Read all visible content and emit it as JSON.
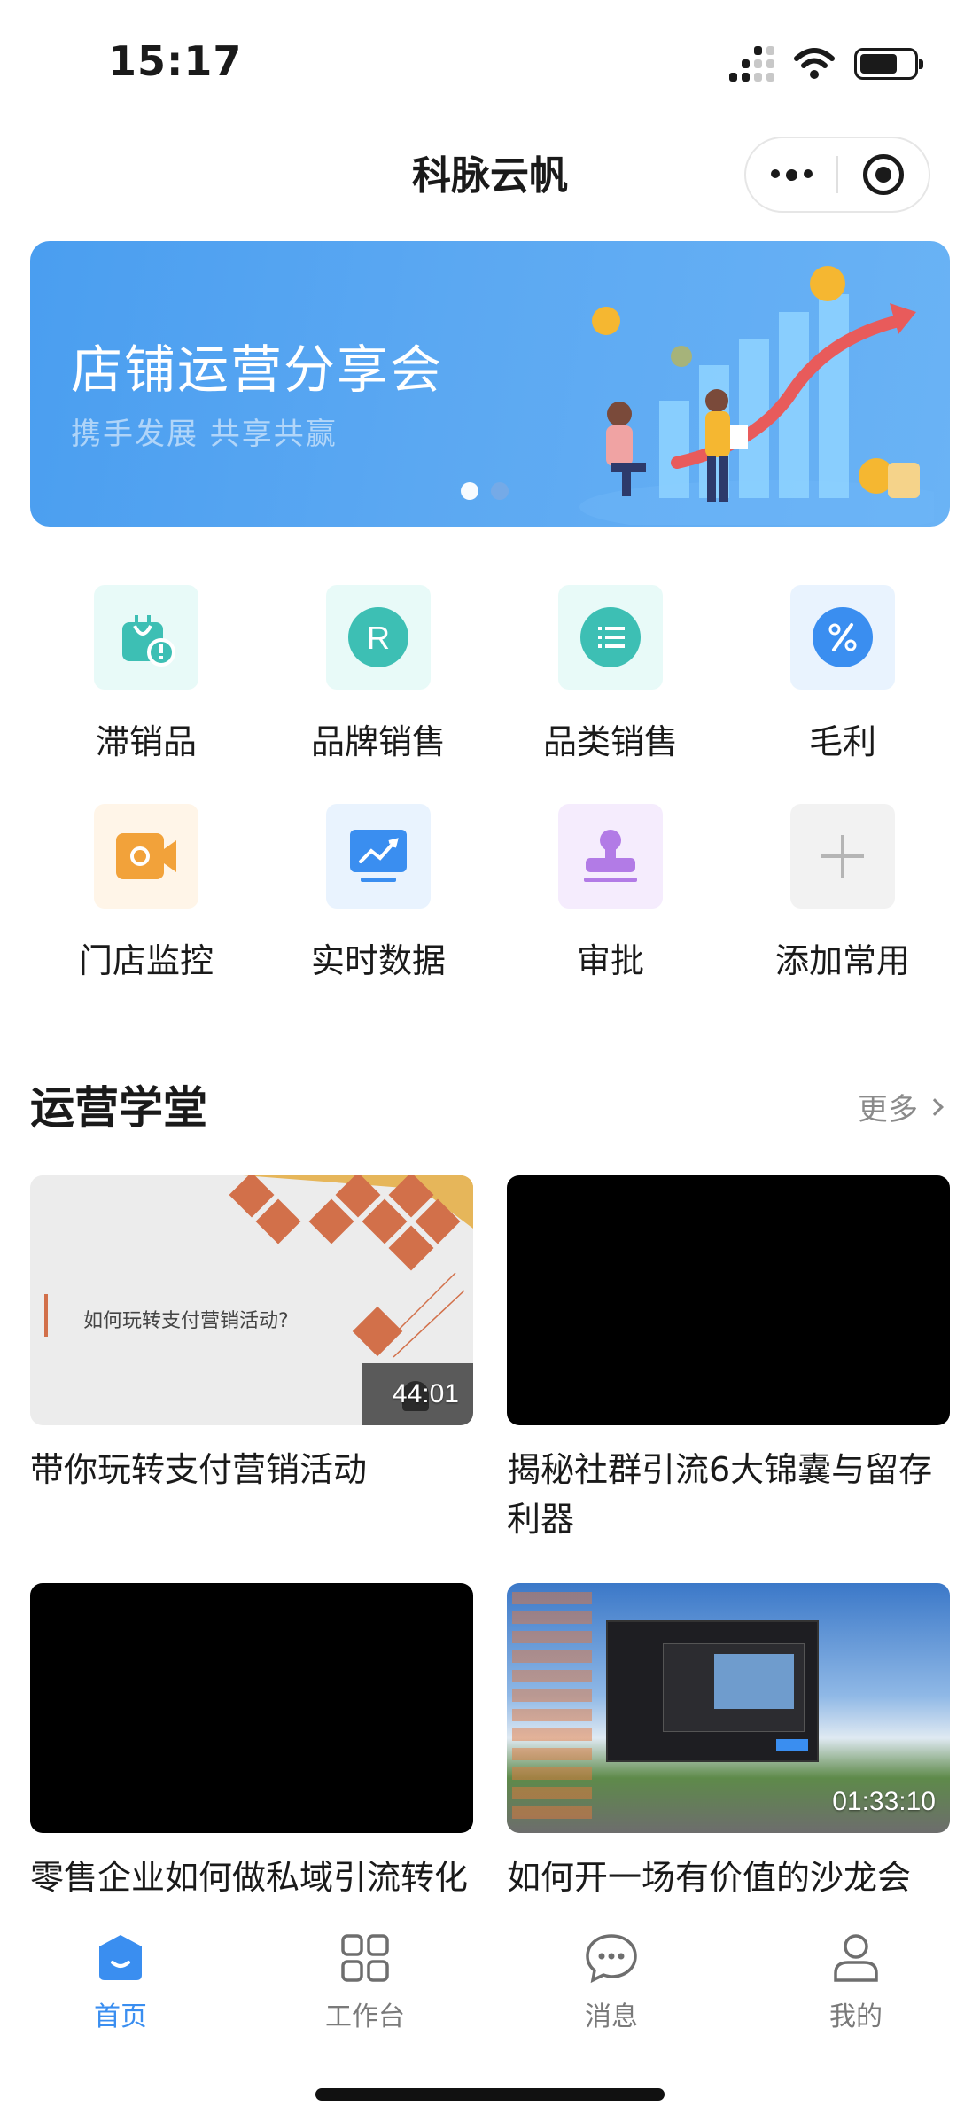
{
  "status": {
    "time": "15:17"
  },
  "nav": {
    "title": "科脉云帆"
  },
  "banner": {
    "title": "店铺运营分享会",
    "subtitle": "携手发展  共享共赢"
  },
  "grid": [
    {
      "label": "滞销品",
      "icon": "bag-warning-icon",
      "bg": "#e8faf8",
      "color": "#3dbfb4"
    },
    {
      "label": "品牌销售",
      "icon": "brand-r-icon",
      "bg": "#e8faf8",
      "color": "#3dbfb4"
    },
    {
      "label": "品类销售",
      "icon": "list-icon",
      "bg": "#e8faf8",
      "color": "#3dbfb4"
    },
    {
      "label": "毛利",
      "icon": "percent-icon",
      "bg": "#e9f3fe",
      "color": "#3a8ef0"
    },
    {
      "label": "门店监控",
      "icon": "camera-icon",
      "bg": "#fff5e8",
      "color": "#f2a23a"
    },
    {
      "label": "实时数据",
      "icon": "chart-monitor-icon",
      "bg": "#e9f3fe",
      "color": "#3a8ef0"
    },
    {
      "label": "审批",
      "icon": "stamp-icon",
      "bg": "#f5ecfd",
      "color": "#b27be6"
    },
    {
      "label": "添加常用",
      "icon": "plus-icon",
      "bg": "#f2f2f2",
      "color": "#b5b5b5"
    }
  ],
  "section": {
    "title": "运营学堂",
    "more": "更多"
  },
  "courses": [
    {
      "title": "带你玩转支付营销活动",
      "slide_text": "如何玩转支付营销活动?",
      "duration": "44:01"
    },
    {
      "title": "揭秘社群引流6大锦囊与留存利器",
      "duration": ""
    },
    {
      "title": "零售企业如何做私域引流转化",
      "duration": ""
    },
    {
      "title": "如何开一场有价值的沙龙会",
      "duration": "01:33:10"
    }
  ],
  "tabs": [
    {
      "label": "首页",
      "icon": "home-icon"
    },
    {
      "label": "工作台",
      "icon": "grid-icon"
    },
    {
      "label": "消息",
      "icon": "chat-icon"
    },
    {
      "label": "我的",
      "icon": "user-icon"
    }
  ]
}
